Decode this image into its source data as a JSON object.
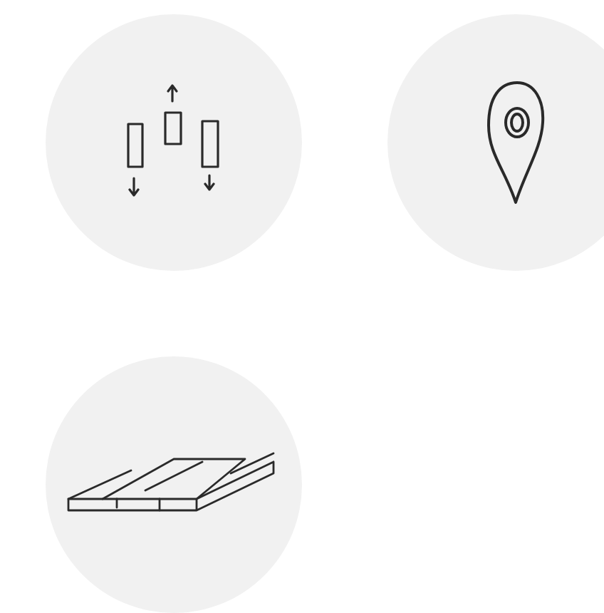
{
  "icons": [
    {
      "kind": "bars"
    },
    {
      "kind": "pin"
    },
    {
      "kind": "boards"
    }
  ]
}
